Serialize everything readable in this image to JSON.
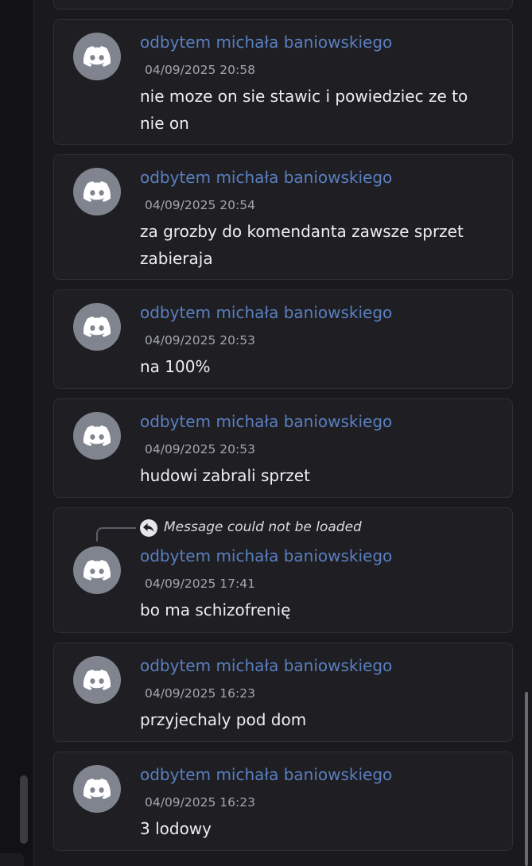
{
  "messages": [
    {
      "author": "odbytem michała baniowskiego",
      "time": "04/09/2025 20:58",
      "text": "nie moze on sie stawic i powiedziec ze to nie on"
    },
    {
      "author": "odbytem michała baniowskiego",
      "time": "04/09/2025 20:54",
      "text": "za grozby do komendanta zawsze sprzet zabieraja"
    },
    {
      "author": "odbytem michała baniowskiego",
      "time": "04/09/2025 20:53",
      "text": "na 100%"
    },
    {
      "author": "odbytem michała baniowskiego",
      "time": "04/09/2025 20:53",
      "text": "hudowi zabrali sprzet"
    },
    {
      "author": "odbytem michała baniowskiego",
      "time": "04/09/2025 17:41",
      "text": "bo ma schizofrenię",
      "reply": "Message could not be loaded"
    },
    {
      "author": "odbytem michała baniowskiego",
      "time": "04/09/2025 16:23",
      "text": "przyjechaly pod dom"
    },
    {
      "author": "odbytem michała baniowskiego",
      "time": "04/09/2025 16:23",
      "text": "3 lodowy"
    }
  ],
  "avatar_icon": "discord-logo-icon",
  "reply_icon": "reply-arrow-icon",
  "colors": {
    "background": "#1a1a1e",
    "card": "#1e1e23",
    "author": "#5a7fbf",
    "timestamp": "#a3a6ad",
    "text": "#eceef2",
    "avatar": "#80848e"
  }
}
